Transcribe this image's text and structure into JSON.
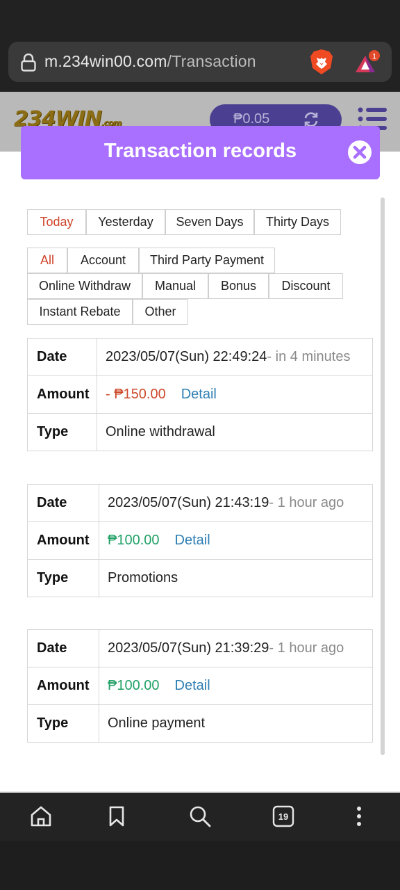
{
  "browser": {
    "url_domain": "m.234win00.com",
    "url_path": "/Transaction",
    "rewards_badge": "1",
    "tab_count": "19"
  },
  "site": {
    "logo": "234WIN",
    "logo_suffix": ".com",
    "balance": "₱0.05"
  },
  "modal": {
    "title": "Transaction records"
  },
  "period_filters": [
    "Today",
    "Yesterday",
    "Seven Days",
    "Thirty Days"
  ],
  "type_filters": [
    "All",
    "Account",
    "Third Party Payment",
    "Online Withdraw",
    "Manual",
    "Bonus",
    "Discount",
    "Instant Rebate",
    "Other"
  ],
  "labels": {
    "date": "Date",
    "amount": "Amount",
    "type": "Type",
    "detail": "Detail"
  },
  "records": [
    {
      "date": "2023/05/07(Sun) 22:49:24",
      "ago": "- in 4 minutes",
      "amount": "- ₱150.00",
      "type": "Online withdrawal"
    },
    {
      "date": "2023/05/07(Sun) 21:43:19",
      "ago": "- 1 hour ago",
      "amount": "₱100.00",
      "type": "Promotions"
    },
    {
      "date": "2023/05/07(Sun) 21:39:29",
      "ago": "- 1 hour ago",
      "amount": "₱100.00",
      "type": "Online payment"
    }
  ],
  "colors": {
    "modal_header": "#a970ff",
    "active_filter": "#d0452a",
    "negative_amount": "#cc4a2a",
    "positive_amount": "#21a066",
    "link": "#2f7fb4"
  }
}
